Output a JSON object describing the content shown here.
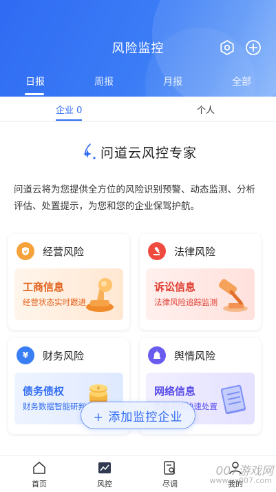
{
  "header": {
    "title": "风险监控",
    "tabs": [
      {
        "label": "日报",
        "active": true
      },
      {
        "label": "周报"
      },
      {
        "label": "月报"
      },
      {
        "label": "全部"
      }
    ]
  },
  "subtabs": [
    {
      "label": "企业 0",
      "active": true
    },
    {
      "label": "个人"
    }
  ],
  "brand": {
    "name": "问道云风控专家"
  },
  "intro": "问道云将为您提供全方位的风险识别预警、动态监测、分析评估、处置提示，为您和您的企业保驾护航。",
  "cards": [
    {
      "title": "经营风险",
      "item_title": "工商信息",
      "item_sub": "经营状态实时跟进",
      "badge_color": "#f5a23a",
      "bg": "#fff1e4",
      "text_color": "#e2601a"
    },
    {
      "title": "法律风险",
      "item_title": "诉讼信息",
      "item_sub": "法律风险追踪监测",
      "badge_color": "#ef4b3e",
      "bg": "#ffece9",
      "text_color": "#df3c2f"
    },
    {
      "title": "财务风险",
      "item_title": "债务债权",
      "item_sub": "财务数据智能研判",
      "badge_color": "#3a7ef5",
      "bg": "#eaf1ff",
      "text_color": "#2f6bf3"
    },
    {
      "title": "舆情风险",
      "item_title": "网络信息",
      "item_sub": "负面舆情快速处置",
      "badge_color": "#6b5cf0",
      "bg": "#eeecff",
      "text_color": "#5a4de8"
    }
  ],
  "add_button": "+ 添加监控企业",
  "bottom_nav": [
    {
      "label": "首页"
    },
    {
      "label": "风控",
      "active": true
    },
    {
      "label": "尽调"
    },
    {
      "label": "我的"
    }
  ],
  "watermark": "007游戏网",
  "watermark_url": "www.yx007.com"
}
